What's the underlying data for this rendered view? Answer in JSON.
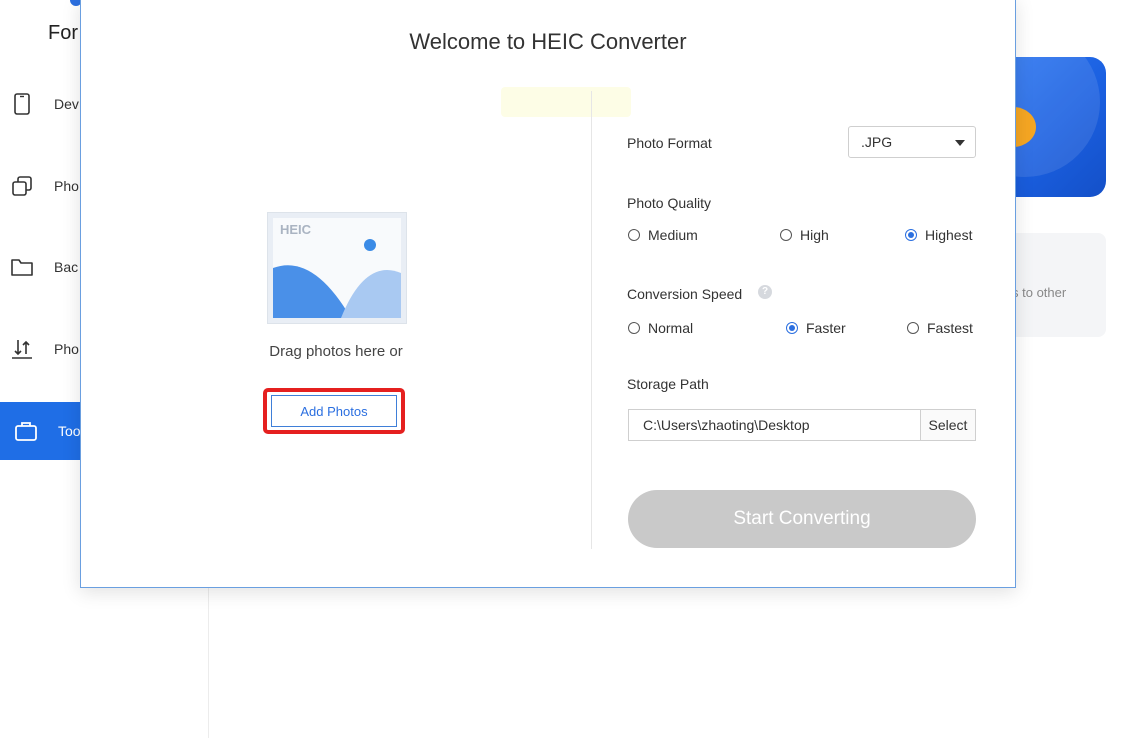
{
  "background": {
    "brand_partial": "For",
    "nav": [
      {
        "label": "Dev",
        "icon": "phone-icon"
      },
      {
        "label": "Pho",
        "icon": "copy-icon"
      },
      {
        "label": "Bac",
        "icon": "folder-icon"
      },
      {
        "label": "Pho",
        "icon": "transfer-icon"
      },
      {
        "label": "Too",
        "icon": "toolbox-icon",
        "active": true
      }
    ],
    "card_text": "s to other",
    "accent": "#1f6ee6"
  },
  "dialog": {
    "title": "Welcome to HEIC Converter",
    "thumbnail_label": "HEIC",
    "drag_text": "Drag photos here or",
    "add_photos": "Add Photos",
    "photo_format": {
      "label": "Photo Format",
      "value": ".JPG"
    },
    "photo_quality": {
      "label": "Photo Quality",
      "options": [
        "Medium",
        "High",
        "Highest"
      ],
      "selected": "Highest"
    },
    "conversion_speed": {
      "label": "Conversion Speed",
      "help": "?",
      "options": [
        "Normal",
        "Faster",
        "Fastest"
      ],
      "selected": "Faster"
    },
    "storage_path": {
      "label": "Storage Path",
      "value": "C:\\Users\\zhaoting\\Desktop",
      "select": "Select"
    },
    "start_button": "Start Converting"
  }
}
